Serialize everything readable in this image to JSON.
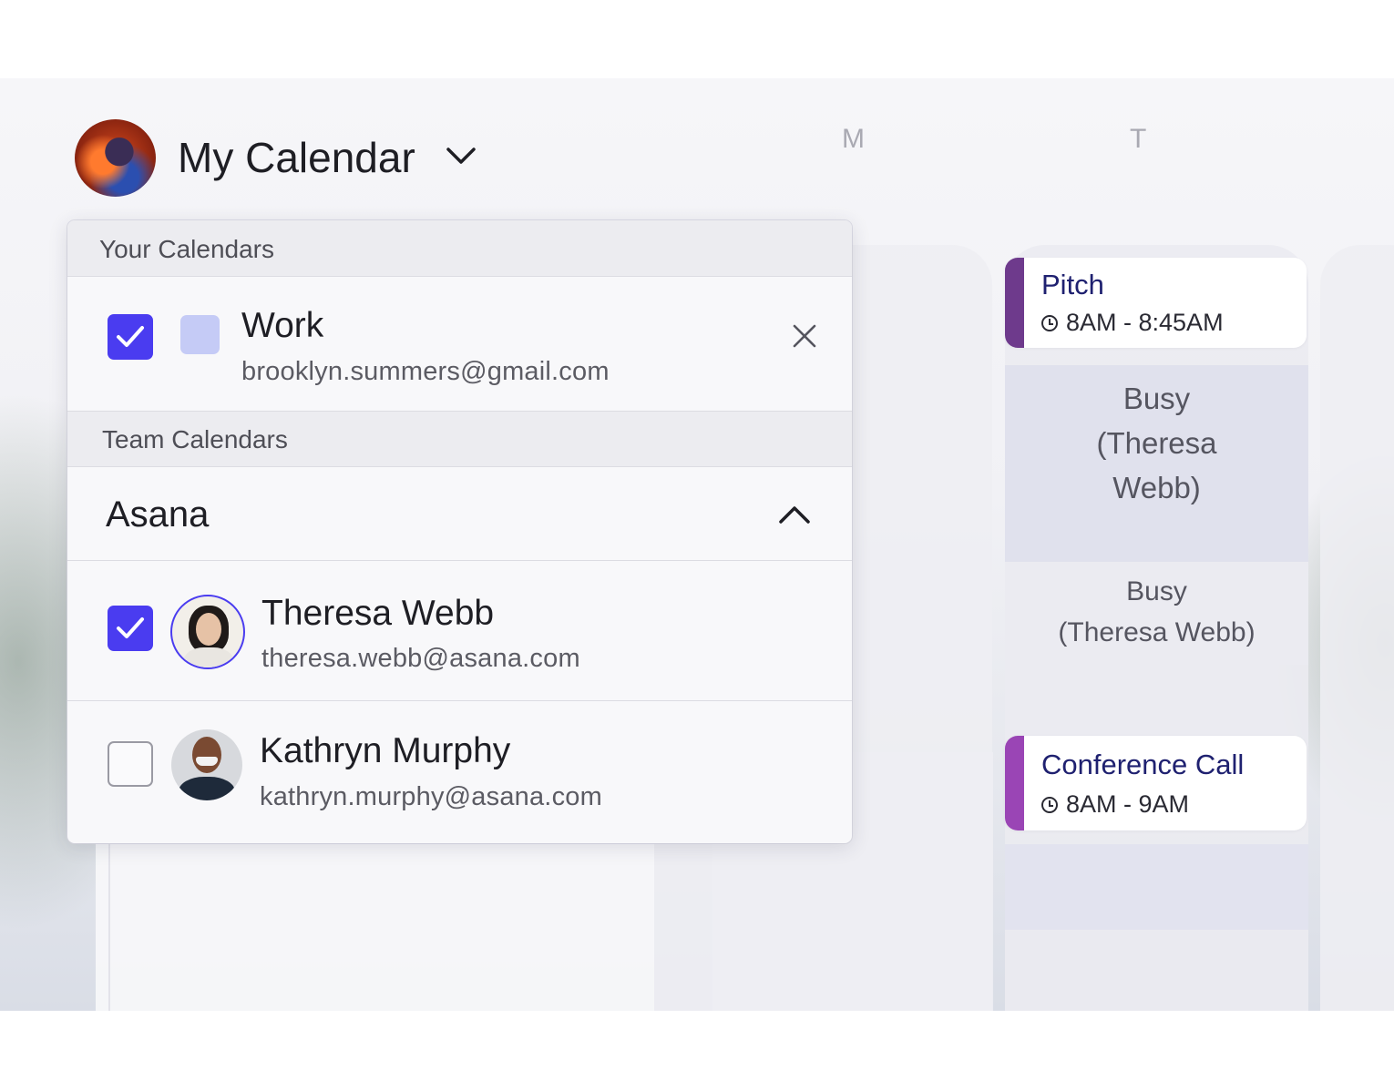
{
  "header": {
    "title": "My Calendar"
  },
  "week": {
    "days": [
      "M",
      "T"
    ]
  },
  "events": {
    "pitch": {
      "title": "Pitch",
      "time": "8AM - 8:45AM",
      "color": "#6e3a8c"
    },
    "busy_1": {
      "lines": [
        "Busy",
        "(Theresa",
        "Webb)"
      ]
    },
    "busy_2": {
      "lines": [
        "Busy",
        "(Theresa Webb)"
      ]
    },
    "conference": {
      "title": "Conference Call",
      "time": "8AM - 9AM",
      "color": "#9a45b5"
    }
  },
  "panel": {
    "your_calendars_heading": "Your Calendars",
    "work": {
      "name": "Work",
      "email": "brooklyn.summers@gmail.com",
      "checked": true,
      "swatch_color": "#c5cbf6"
    },
    "team_calendars_heading": "Team Calendars",
    "team_name": "Asana",
    "members": [
      {
        "name": "Theresa Webb",
        "email": "theresa.webb@asana.com",
        "checked": true
      },
      {
        "name": "Kathryn Murphy",
        "email": "kathryn.murphy@asana.com",
        "checked": false
      }
    ]
  },
  "colors": {
    "accent": "#4a3cf0",
    "event_title": "#1f2170"
  }
}
